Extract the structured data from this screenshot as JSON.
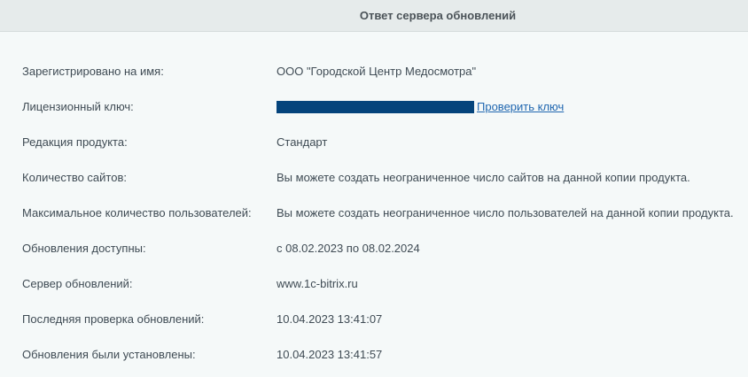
{
  "header": {
    "title": "Ответ сервера обновлений"
  },
  "rows": [
    {
      "label": "Зарегистрировано на имя:",
      "value": "ООО \"Городской Центр Медосмотра\""
    },
    {
      "label": "Лицензионный ключ:",
      "value": "",
      "link": "Проверить ключ"
    },
    {
      "label": "Редакция продукта:",
      "value": "Стандарт"
    },
    {
      "label": "Количество сайтов:",
      "value": "Вы можете создать неограниченное число сайтов на данной копии продукта."
    },
    {
      "label": "Максимальное количество пользователей:",
      "value": "Вы можете создать неограниченное число пользователей на данной копии продукта."
    },
    {
      "label": "Обновления доступны:",
      "value": "с 08.02.2023 по 08.02.2024"
    },
    {
      "label": "Сервер обновлений:",
      "value": "www.1c-bitrix.ru"
    },
    {
      "label": "Последняя проверка обновлений:",
      "value": "10.04.2023 13:41:07"
    },
    {
      "label": "Обновления были установлены:",
      "value": "10.04.2023 13:41:57"
    }
  ],
  "colors": {
    "key_mask": "#04447c",
    "link": "#2067b0"
  }
}
